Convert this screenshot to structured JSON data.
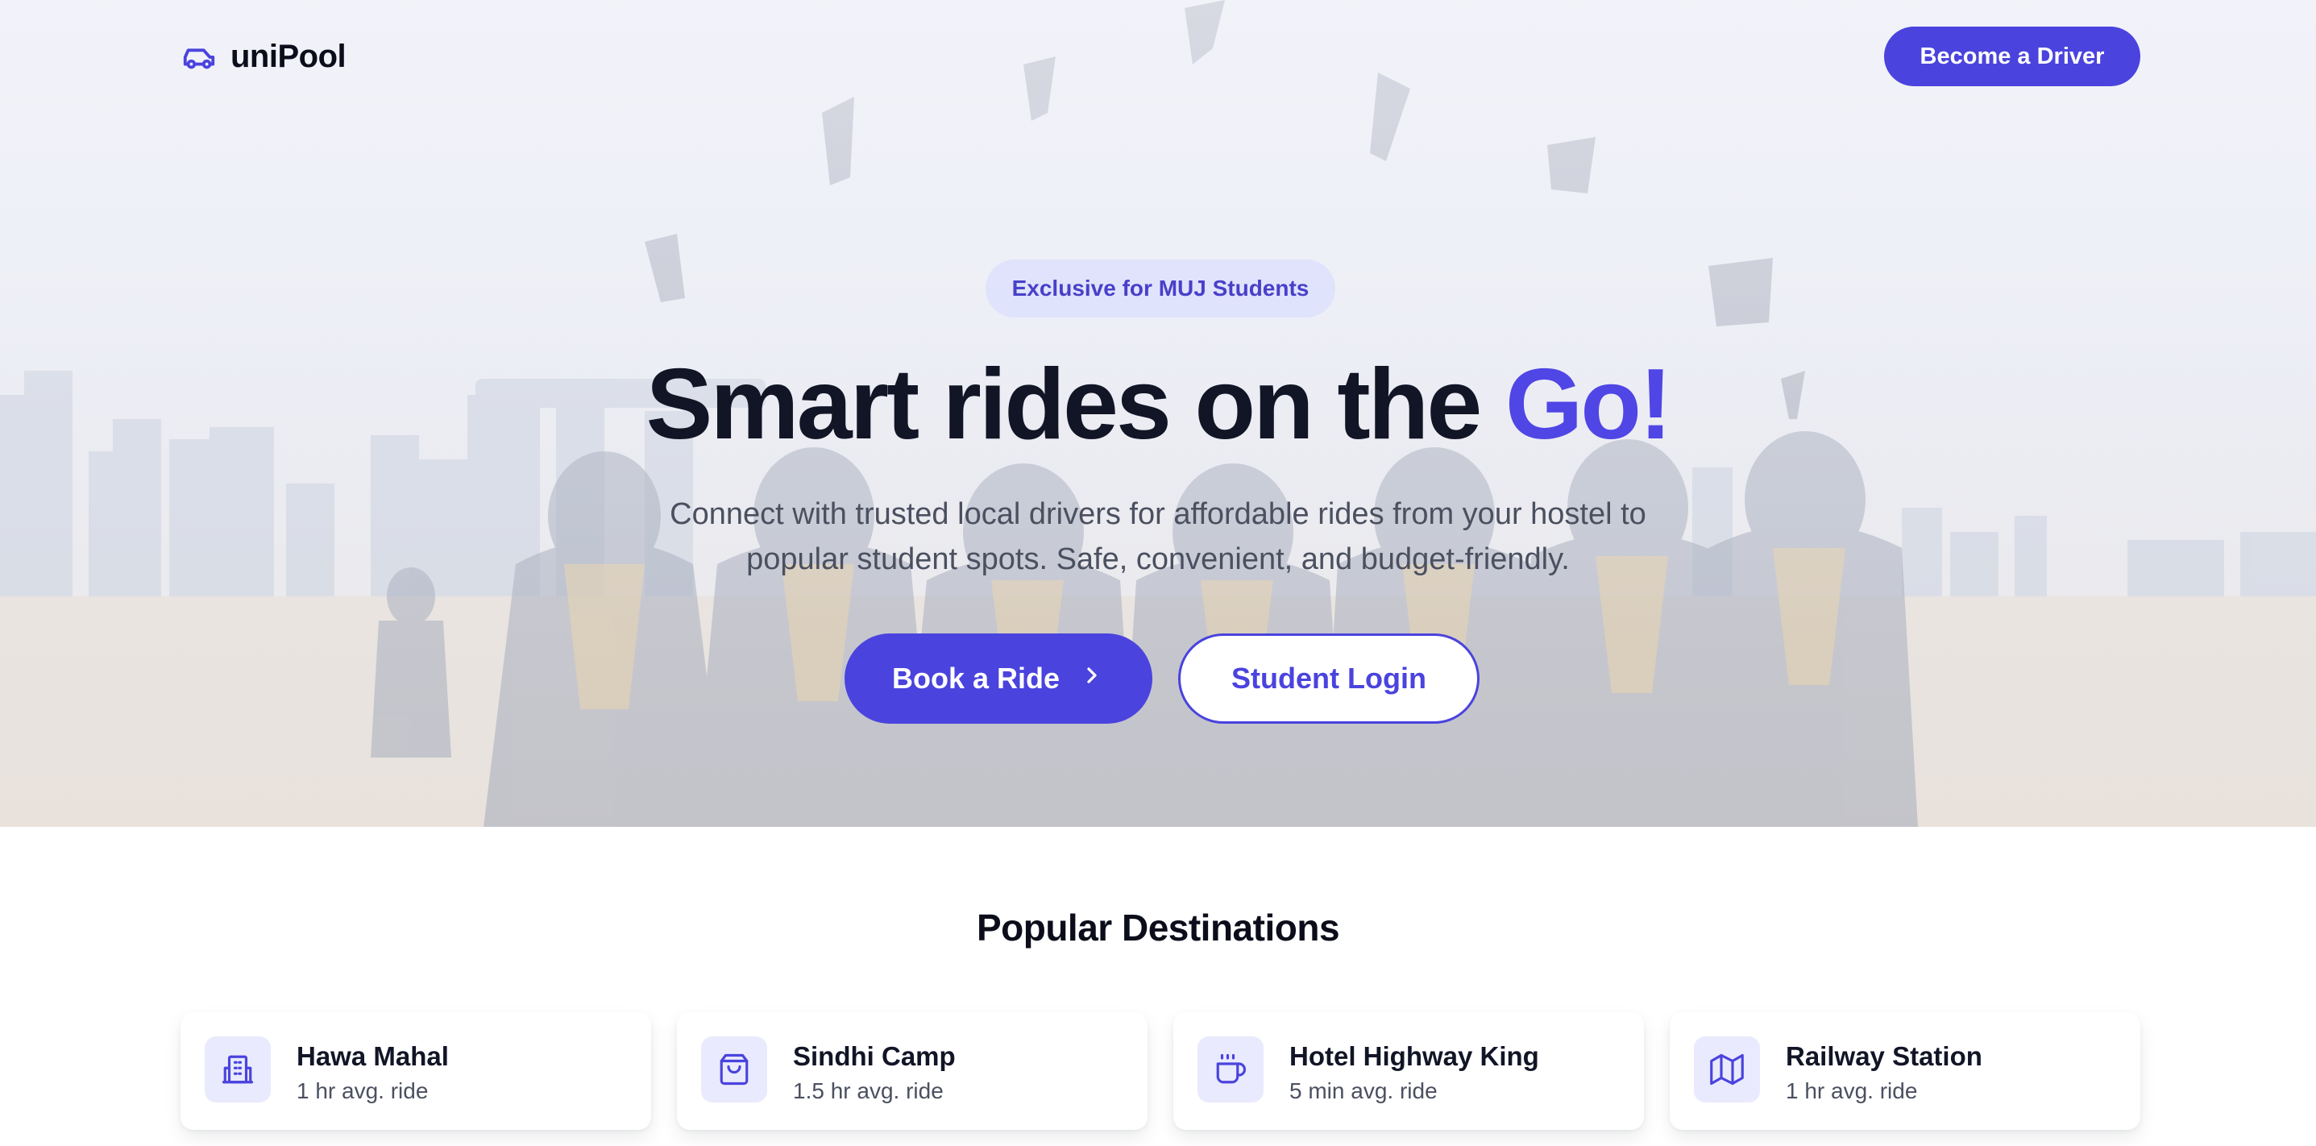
{
  "nav": {
    "brand": "uniPool",
    "brand_icon": "car-icon",
    "driver_button": "Become a Driver"
  },
  "hero": {
    "badge": "Exclusive for MUJ Students",
    "headline_main": "Smart rides on the ",
    "headline_accent": "Go!",
    "subtitle": "Connect with trusted local drivers for affordable rides from your hostel to popular student spots. Safe, convenient, and budget-friendly.",
    "primary_cta": "Book a Ride",
    "primary_cta_icon": "chevron-right-icon",
    "secondary_cta": "Student Login",
    "background": "graduation-photo"
  },
  "destinations": {
    "title": "Popular Destinations",
    "items": [
      {
        "name": "Hawa Mahal",
        "time": "1 hr avg. ride",
        "icon": "building-icon"
      },
      {
        "name": "Sindhi Camp",
        "time": "1.5 hr avg. ride",
        "icon": "shopping-bag-icon"
      },
      {
        "name": "Hotel Highway King",
        "time": "5 min avg. ride",
        "icon": "coffee-icon"
      },
      {
        "name": "Railway Station",
        "time": "1 hr avg. ride",
        "icon": "map-icon"
      }
    ]
  },
  "colors": {
    "primary": "#4a43de",
    "accent_text": "#4f46e5",
    "badge_bg": "#dfe2fc",
    "heading": "#111526",
    "body_text": "#4b5060"
  }
}
